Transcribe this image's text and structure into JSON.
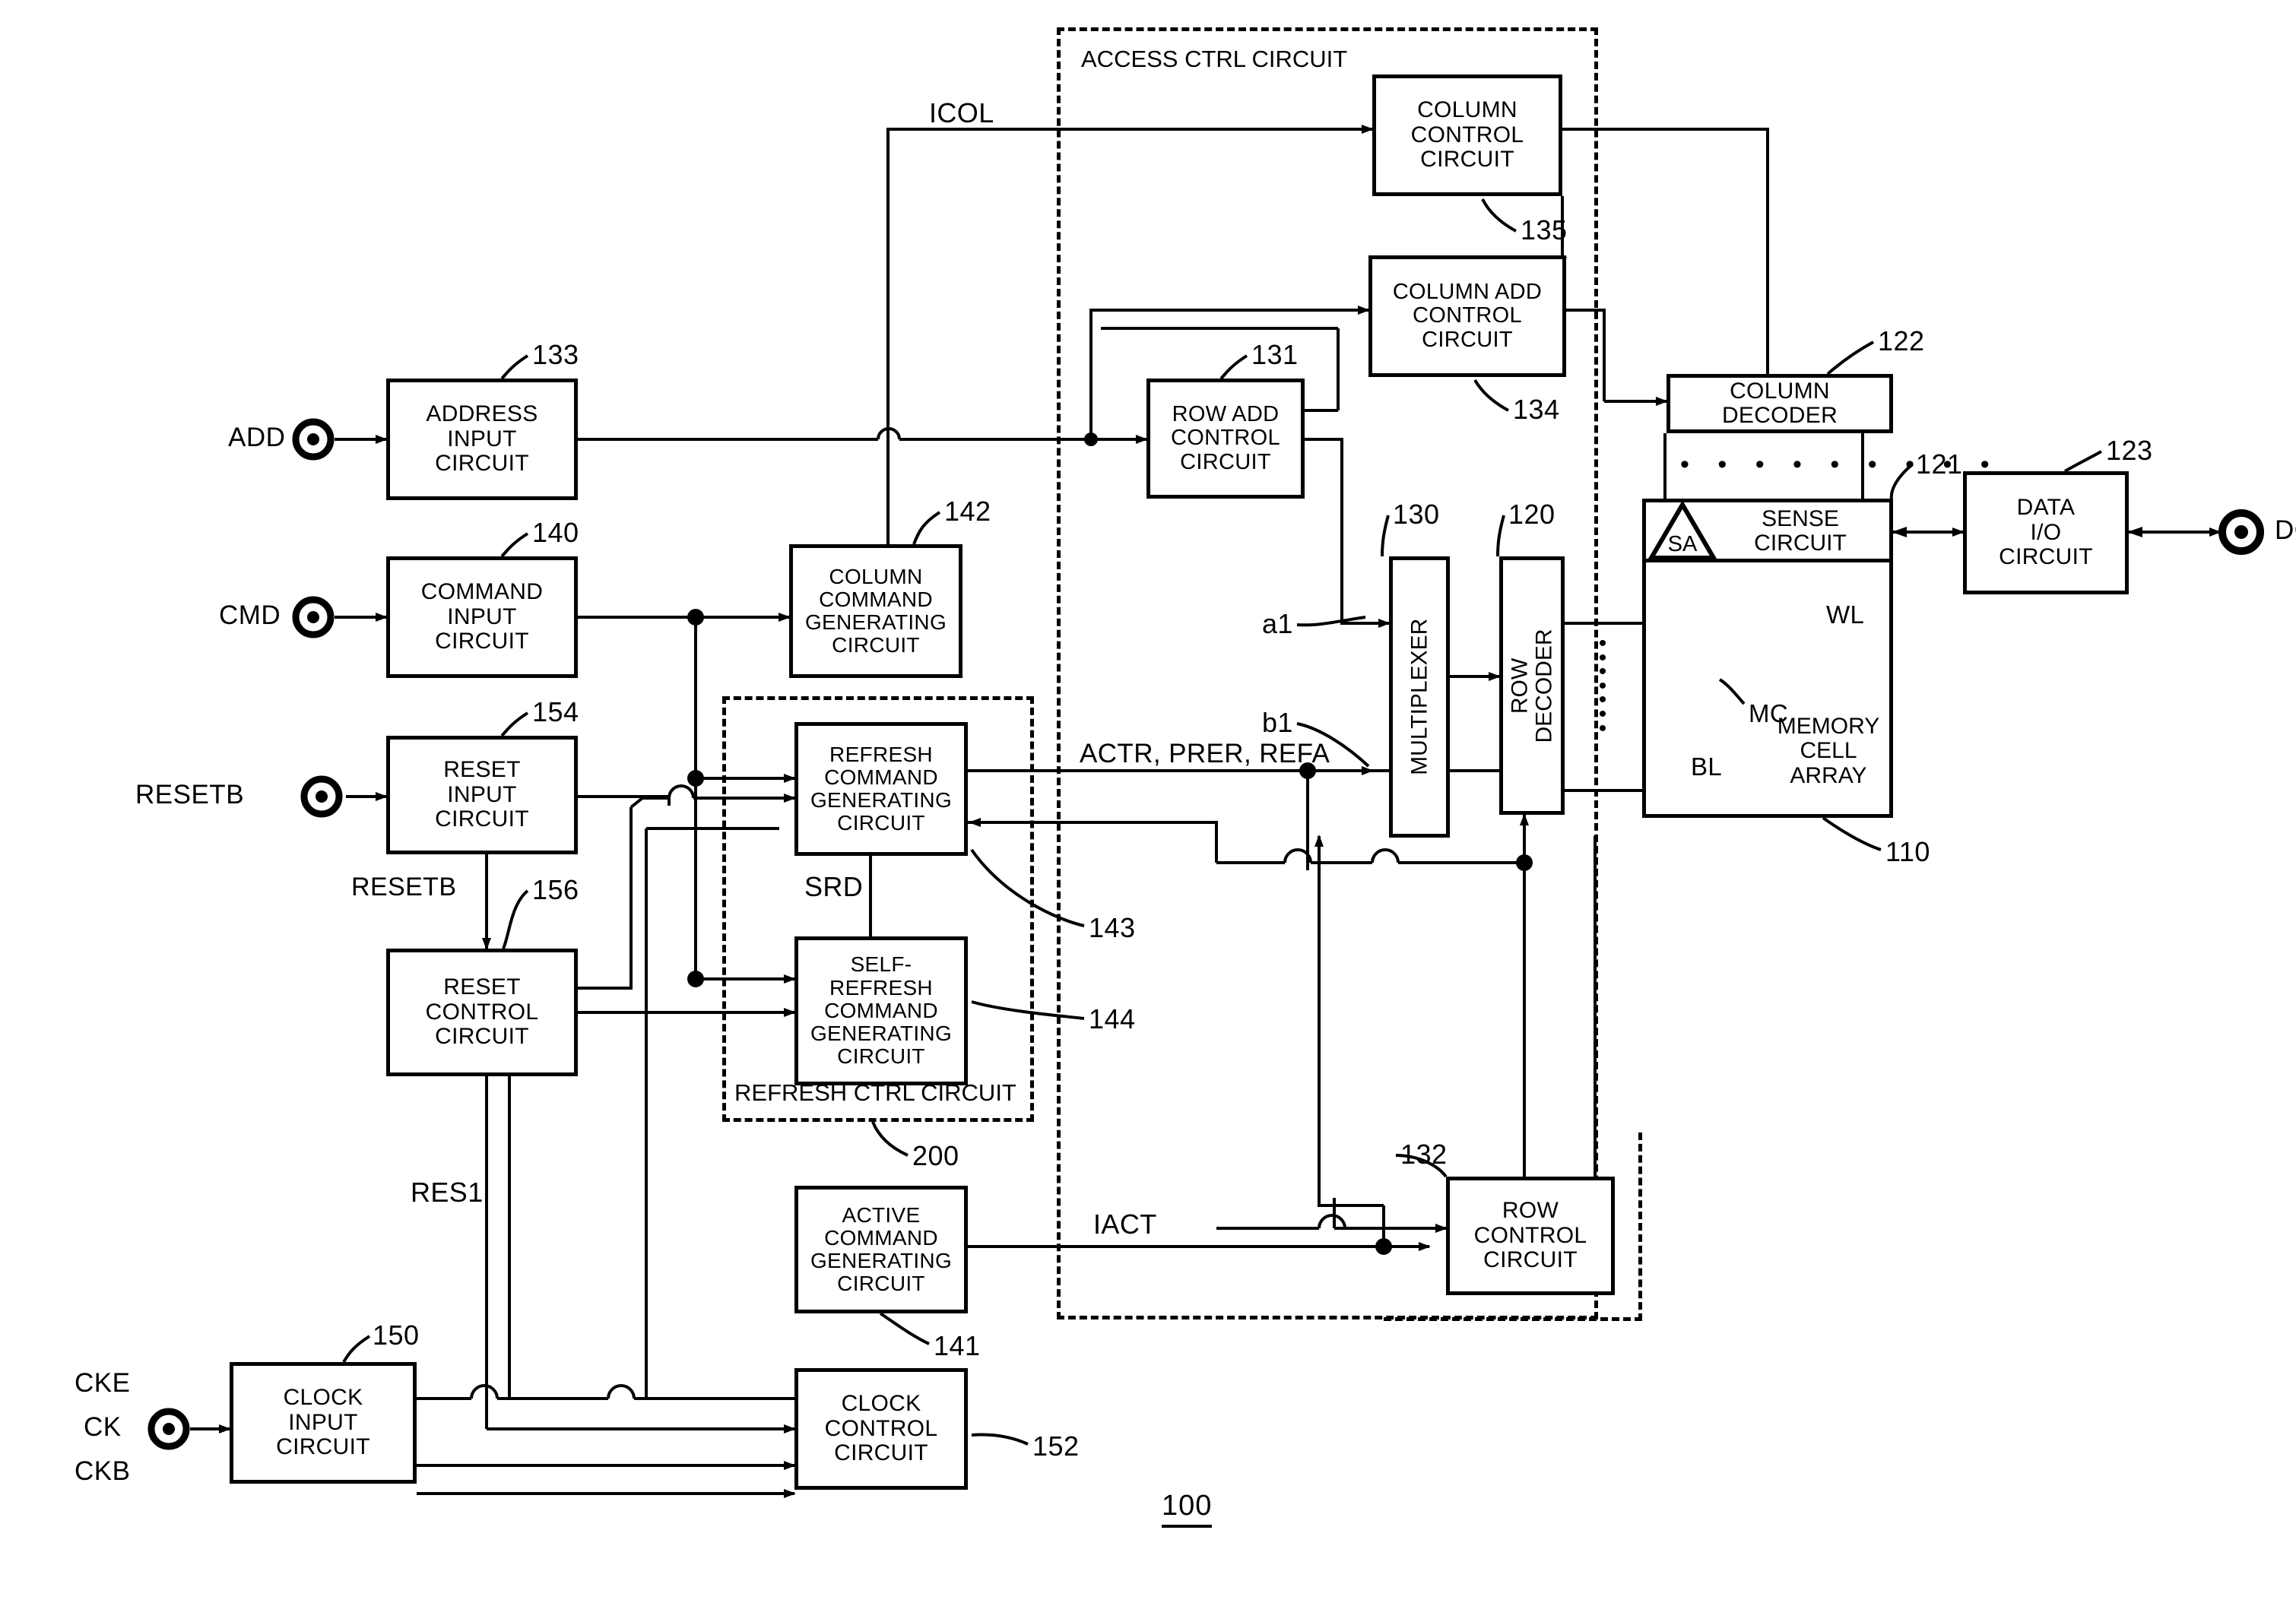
{
  "figure": {
    "number": "100",
    "domain": "semiconductor-memory-block-diagram"
  },
  "pins": [
    {
      "name": "ADD",
      "label": "ADD"
    },
    {
      "name": "CMD",
      "label": "CMD"
    },
    {
      "name": "RESETB",
      "label": "RESETB"
    },
    {
      "name": "CLK",
      "label": "CKE\nCK\nCKB"
    },
    {
      "name": "DQ",
      "label": "DQ"
    }
  ],
  "pin_labels": {
    "add": "ADD",
    "cmd": "CMD",
    "resetb": "RESETB",
    "cke": "CKE",
    "ck": "CK",
    "ckb": "CKB",
    "dq": "DQ"
  },
  "blocks": {
    "address_input": {
      "label": "ADDRESS\nINPUT\nCIRCUIT",
      "ref": "133"
    },
    "command_input": {
      "label": "COMMAND\nINPUT\nCIRCUIT",
      "ref": "140"
    },
    "reset_input": {
      "label": "RESET\nINPUT\nCIRCUIT",
      "ref": "154"
    },
    "reset_control": {
      "label": "RESET\nCONTROL\nCIRCUIT",
      "ref": "156"
    },
    "clock_input": {
      "label": "CLOCK\nINPUT\nCIRCUIT",
      "ref": "150"
    },
    "clock_control": {
      "label": "CLOCK\nCONTROL\nCIRCUIT",
      "ref": "152"
    },
    "column_command_gen": {
      "label": "COLUMN\nCOMMAND\nGENERATING\nCIRCUIT",
      "ref": "142"
    },
    "refresh_command_gen": {
      "label": "REFRESH\nCOMMAND\nGENERATING\nCIRCUIT",
      "ref": "143"
    },
    "self_refresh_cmd_gen": {
      "label": "SELF-\nREFRESH\nCOMMAND\nGENERATING\nCIRCUIT",
      "ref": "144"
    },
    "active_command_gen": {
      "label": "ACTIVE\nCOMMAND\nGENERATING\nCIRCUIT",
      "ref": "141"
    },
    "column_control": {
      "label": "COLUMN\nCONTROL\nCIRCUIT",
      "ref": "135"
    },
    "column_add_control": {
      "label": "COLUMN ADD\nCONTROL\nCIRCUIT",
      "ref": "134"
    },
    "row_add_control": {
      "label": "ROW ADD\nCONTROL\nCIRCUIT",
      "ref": "131"
    },
    "row_control": {
      "label": "ROW\nCONTROL\nCIRCUIT",
      "ref": "132"
    },
    "multiplexer": {
      "label": "MULTIPLEXER",
      "ref": "130"
    },
    "row_decoder": {
      "label": "ROW\nDECODER",
      "ref": "120"
    },
    "column_decoder": {
      "label": "COLUMN\nDECODER",
      "ref": "122"
    },
    "sense_circuit": {
      "label": "SENSE\nCIRCUIT",
      "ref": "121"
    },
    "memory_cell_array": {
      "label": "MEMORY\nCELL\nARRAY",
      "ref": "110"
    },
    "data_io": {
      "label": "DATA\nI/O\nCIRCUIT",
      "ref": "123"
    }
  },
  "dashed_groups": {
    "access_ctrl": {
      "label": "ACCESS CTRL CIRCUIT"
    },
    "refresh_ctrl": {
      "label": "REFRESH CTRL CIRCUIT",
      "ref": "200"
    }
  },
  "signals": {
    "icol": "ICOL",
    "iact": "IACT",
    "actr_prer_refa": "ACTR, PRER, REFA",
    "srd": "SRD",
    "resetb_internal": "RESETB",
    "res1": "RES1",
    "a1": "a1",
    "b1": "b1"
  },
  "array_internal": {
    "sa": "SA",
    "wl": "WL",
    "bl": "BL",
    "mc": "MC"
  },
  "ellipsis": {
    "horizontal": "• • • • • • • • •",
    "vertical": "•\n•\n•\n•\n•\n•\n•"
  },
  "colors": {
    "ink": "#000000",
    "paper": "#ffffff"
  }
}
